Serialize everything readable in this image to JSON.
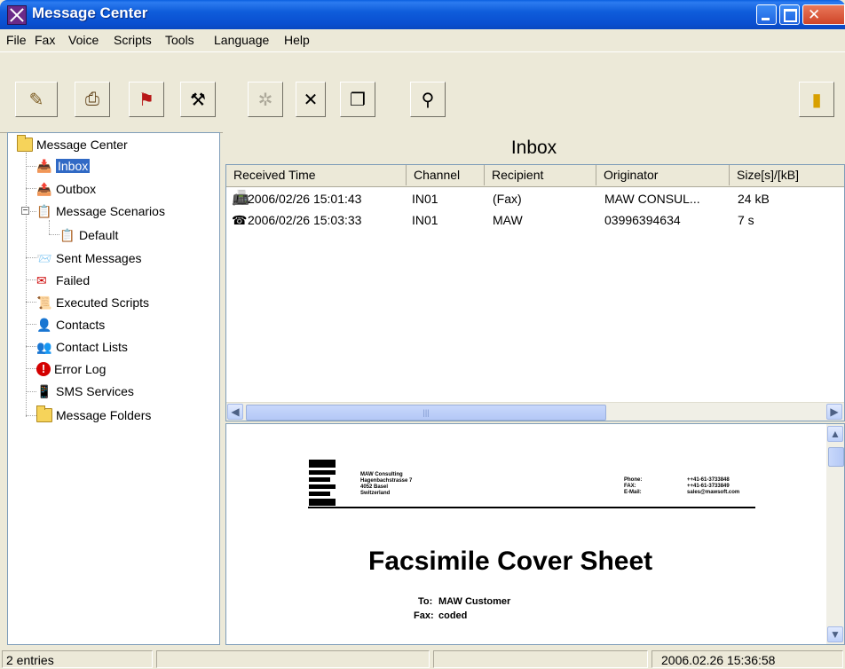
{
  "window": {
    "title": "Message Center"
  },
  "menu": [
    "File",
    "Fax",
    "Voice",
    "Scripts",
    "Tools",
    "Language",
    "Help"
  ],
  "toolbar": {
    "buttons": [
      {
        "icon": "new-message-icon"
      },
      {
        "icon": "fax-sender-icon"
      },
      {
        "icon": "scenario-icon"
      },
      {
        "icon": "tools-icon"
      },
      {
        "icon": "disabled-action-icon"
      },
      {
        "icon": "delete-icon"
      },
      {
        "icon": "copy-icon"
      },
      {
        "icon": "connect-icon"
      },
      {
        "icon": "exit-icon"
      }
    ]
  },
  "tree": {
    "root": "Message Center",
    "items": [
      {
        "label": "Inbox",
        "icon": "inbox-icon",
        "selected": true
      },
      {
        "label": "Outbox",
        "icon": "outbox-icon"
      },
      {
        "label": "Message Scenarios",
        "icon": "scenarios-icon"
      },
      {
        "label": "Default",
        "icon": "scenario-default-icon"
      },
      {
        "label": "Sent Messages",
        "icon": "sent-icon"
      },
      {
        "label": "Failed",
        "icon": "failed-icon"
      },
      {
        "label": "Executed Scripts",
        "icon": "scripts-icon"
      },
      {
        "label": "Contacts",
        "icon": "contact-icon"
      },
      {
        "label": "Contact Lists",
        "icon": "contact-list-icon"
      },
      {
        "label": "Error Log",
        "icon": "error-icon"
      },
      {
        "label": "SMS Services",
        "icon": "sms-icon"
      },
      {
        "label": "Message Folders",
        "icon": "folder-icon"
      }
    ]
  },
  "inbox": {
    "title": "Inbox",
    "columns": [
      "Received Time",
      "Channel",
      "Recipient",
      "Originator",
      "Size[s]/[kB]"
    ],
    "rows": [
      {
        "icon": "fax-message-icon",
        "time": "2006/02/26  15:01:43",
        "channel": "IN01",
        "recipient": "(Fax)",
        "originator": "MAW CONSUL...",
        "size": "24 kB"
      },
      {
        "icon": "voice-message-icon",
        "time": "2006/02/26  15:03:33",
        "channel": "IN01",
        "recipient": "MAW",
        "originator": "03996394634",
        "size": "7 s"
      }
    ]
  },
  "preview": {
    "company_lines": "MAW Consulting\nHagenbachstrasse 7\n4052 Basel\nSwitzerland",
    "contact_labels": "Phone:\nFAX:\nE-Mail:",
    "contact_values": "++41-61-3733848\n++41-61-3733849\nsales@mawsoft.com",
    "title": "Facsimile Cover Sheet",
    "to_label": "To:",
    "to_value": "MAW Customer",
    "fax_label": "Fax:",
    "fax_value": "coded"
  },
  "status": {
    "entries": "2 entries",
    "datetime": "2006.02.26 15:36:58"
  }
}
